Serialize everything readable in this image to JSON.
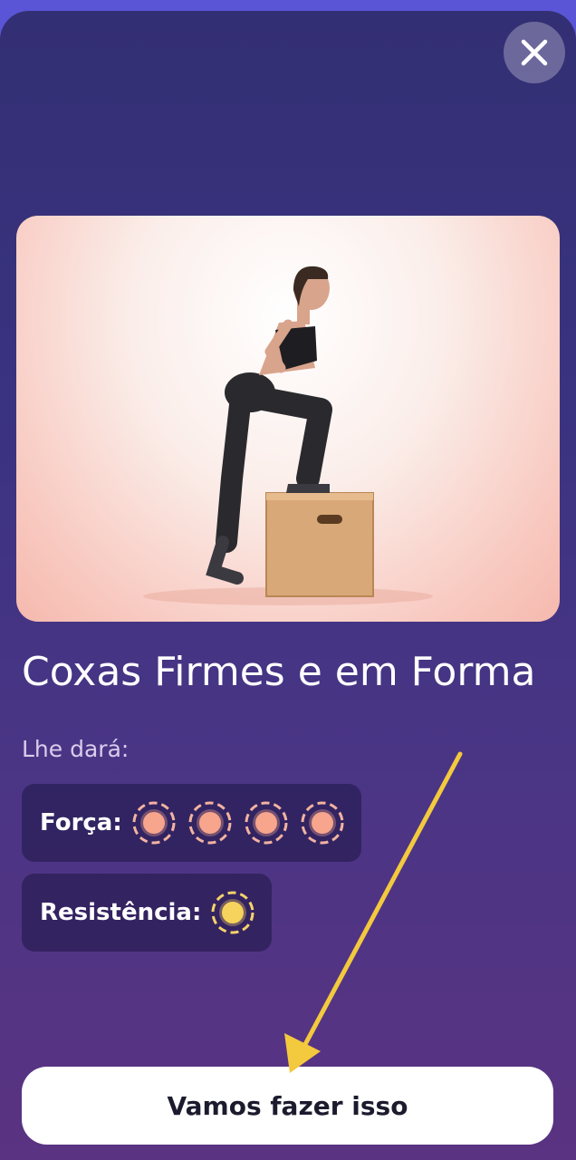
{
  "program": {
    "title": "Coxas Firmes e em Forma",
    "subtitle": "Lhe dará:",
    "hero_image": "woman-step-up-on-wooden-box"
  },
  "stats": [
    {
      "label": "Força:",
      "level": 4,
      "color": "#f7a58c",
      "ring": "#f3b3a0"
    },
    {
      "label": "Resistência:",
      "level": 1,
      "color": "#f6d35c",
      "ring": "#f4d36a"
    }
  ],
  "cta": {
    "label": "Vamos fazer isso"
  },
  "icons": {
    "close": "close-icon"
  },
  "colors": {
    "accent_arrow": "#f3c93e",
    "background": "#3a3380"
  }
}
